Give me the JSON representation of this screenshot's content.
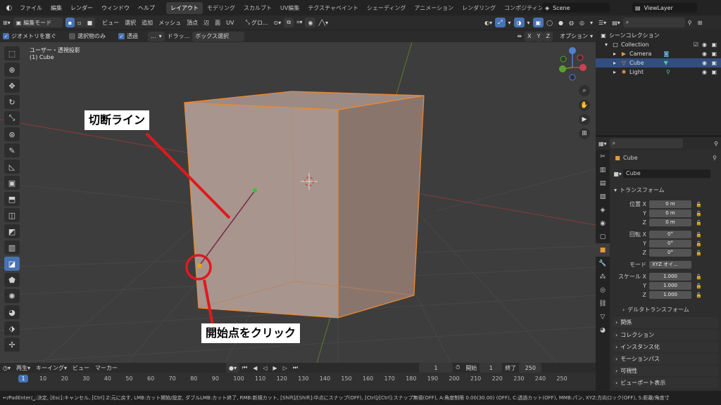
{
  "topbar": {
    "menus": [
      "ファイル",
      "編集",
      "レンダー",
      "ウィンドウ",
      "ヘルプ"
    ],
    "workspaces": [
      "レイアウト",
      "モデリング",
      "スカルプト",
      "UV編集",
      "テクスチャペイント",
      "シェーディング",
      "アニメーション",
      "レンダリング",
      "コンポジティング"
    ],
    "scene": "Scene",
    "view_layer": "ViewLayer"
  },
  "vp_header": {
    "mode": "編集モード",
    "menus": [
      "ビュー",
      "選択",
      "追加",
      "メッシュ",
      "頂点",
      "辺",
      "面",
      "UV"
    ],
    "orientation": "グロ...",
    "axes": [
      "X",
      "Y",
      "Z"
    ],
    "options": "オプション"
  },
  "tool_header": {
    "occlude": "ジオメトリを塞ぐ",
    "only_selected": "選択物のみ",
    "xray": "透過",
    "dots": "...",
    "drag_label": "ドラッ...",
    "drag_value": "ボックス選択"
  },
  "viewport": {
    "view_name": "ユーザー・透視投影",
    "object_label": "(1) Cube"
  },
  "callouts": {
    "cut_line": "切断ライン",
    "start_point": "開始点をクリック"
  },
  "timeline": {
    "menus": [
      "再生",
      "キーイング",
      "ビュー",
      "マーカー"
    ],
    "current_frame": "1",
    "start_label": "開始",
    "start": "1",
    "end_label": "終了",
    "end": "250",
    "ruler": [
      "10",
      "20",
      "30",
      "40",
      "50",
      "60",
      "70",
      "80",
      "90",
      "100",
      "110",
      "120",
      "130",
      "140",
      "150",
      "160",
      "170",
      "180",
      "190",
      "200",
      "210",
      "220",
      "230",
      "240",
      "250"
    ],
    "cursor_frame": "1"
  },
  "statusbar": {
    "text": "↩/PadEnter/␣:決定, [Esc]:キャンセル, [Ctrl] Z:元に戻す, LMB:カット開始/設定, ダブルLMB:カット終了, RMB:新規カット, [Shift]/[Shift]:中点にスナップ(OFF), [Ctrl]/[Ctrl]:スナップ無視(OFF), A:角度制限 0.00(30.00) (OFF), C:透過カット(OFF), MMB:パン, XYZ:方向ロック(OFF), S:距離/角度寸"
  },
  "outliner": {
    "title": "シーンコレクション",
    "collection": "Collection",
    "items": [
      {
        "name": "Camera"
      },
      {
        "name": "Cube"
      },
      {
        "name": "Light"
      }
    ]
  },
  "properties": {
    "object_name": "Cube",
    "data_name": "Cube",
    "transform_title": "トランスフォーム",
    "location_label": "位置 X",
    "rotation_label": "回転 X",
    "scale_label": "スケール X",
    "axis_y": "Y",
    "axis_z": "Z",
    "location": [
      "0 m",
      "0 m",
      "0 m"
    ],
    "rotation": [
      "0°",
      "0°",
      "0°"
    ],
    "mode_label": "モード",
    "mode_value": "XYZ オイ...",
    "scale": [
      "1.000",
      "1.000",
      "1.000"
    ],
    "delta_transform": "デルタトランスフォーム",
    "sections": [
      "関係",
      "コレクション",
      "インスタンス化",
      "モーションパス",
      "可視性",
      "ビューポート表示"
    ]
  },
  "colors": {
    "accent": "#4772b3",
    "selection_orange": "#f0892e",
    "annotation_red": "#e0191e"
  }
}
